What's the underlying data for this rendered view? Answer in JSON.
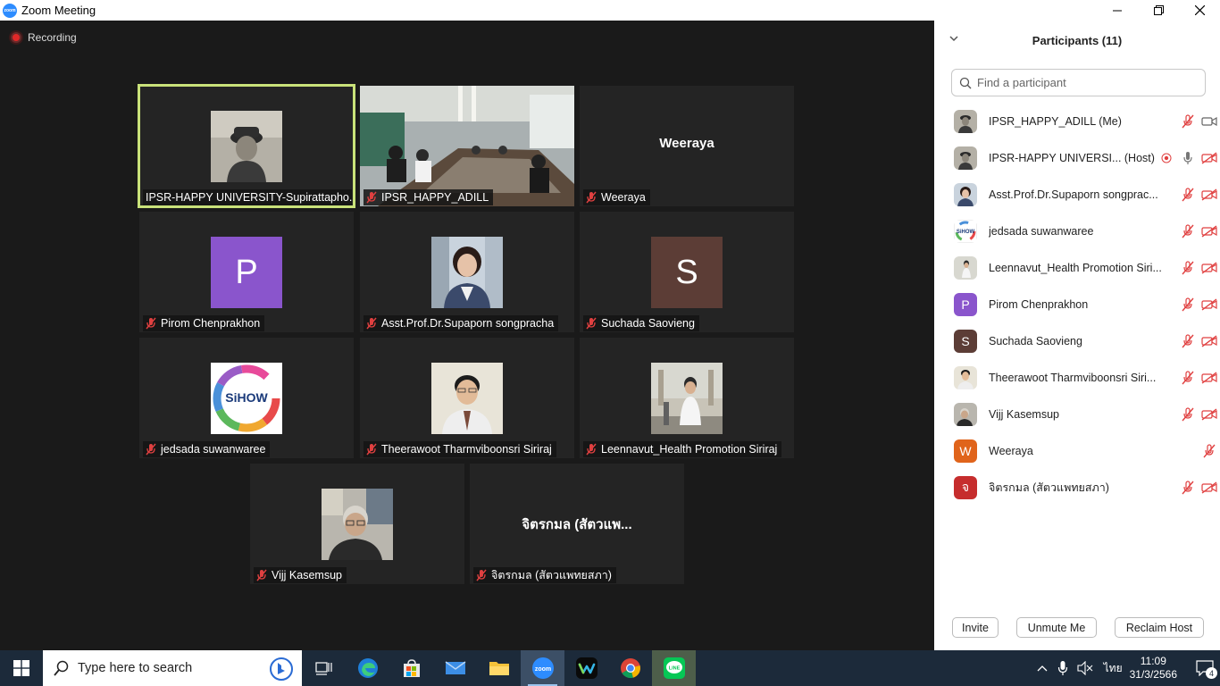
{
  "window": {
    "title": "Zoom Meeting",
    "minimize": "—",
    "restore": "❐",
    "close": "✕",
    "app_icon": "zoom"
  },
  "recording": {
    "label": "Recording"
  },
  "tiles": [
    {
      "name": "IPSR-HAPPY UNIVERSITY-Supirattapho...",
      "kind": "photo-bw",
      "muted": false
    },
    {
      "name": "IPSR_HAPPY_ADILL",
      "kind": "video-room",
      "muted": true
    },
    {
      "name": "Weeraya",
      "kind": "text",
      "center_text": "Weeraya",
      "muted": true
    },
    {
      "name": "Pirom Chenprakhon",
      "kind": "avatar",
      "initial": "P",
      "color": "#8a55cc",
      "muted": true
    },
    {
      "name": "Asst.Prof.Dr.Supaporn songpracha",
      "kind": "photo-woman",
      "muted": true
    },
    {
      "name": "Suchada Saovieng",
      "kind": "avatar",
      "initial": "S",
      "color": "#5c3d36",
      "muted": true
    },
    {
      "name": "jedsada suwanwaree",
      "kind": "logo-sihow",
      "logo_text": "SiHOW",
      "muted": true
    },
    {
      "name": "Theerawoot Tharmviboonsri Siriraj",
      "kind": "photo-man",
      "muted": true
    },
    {
      "name": "Leennavut_Health Promotion Siriraj",
      "kind": "photo-outdoor",
      "muted": true
    },
    {
      "name": "Vijj Kasemsup",
      "kind": "photo-elder",
      "muted": true
    },
    {
      "name": "จิตรกมล (สัตวแพทยสภา)",
      "kind": "text",
      "center_text": "จิตรกมล (สัตวแพ...",
      "muted": true
    }
  ],
  "panel": {
    "title": "Participants (11)",
    "search_placeholder": "Find a participant",
    "participants": [
      {
        "name": "IPSR_HAPPY_ADILL (Me)",
        "avatar": "photo-bw",
        "mic": "muted",
        "video": "on"
      },
      {
        "name": "IPSR-HAPPY UNIVERSI... (Host)",
        "avatar": "photo-bw",
        "mic": "active",
        "video": "off",
        "recording": true
      },
      {
        "name": "Asst.Prof.Dr.Supaporn songprac...",
        "avatar": "photo-woman",
        "mic": "muted",
        "video": "off"
      },
      {
        "name": "jedsada suwanwaree",
        "avatar": "logo-sihow",
        "mic": "muted",
        "video": "off"
      },
      {
        "name": "Leennavut_Health Promotion Siri...",
        "avatar": "photo-outdoor",
        "mic": "muted",
        "video": "off"
      },
      {
        "name": "Pirom Chenprakhon",
        "avatar": "initial",
        "initial": "P",
        "color": "#8a55cc",
        "mic": "muted",
        "video": "off"
      },
      {
        "name": "Suchada Saovieng",
        "avatar": "initial",
        "initial": "S",
        "color": "#5c3d36",
        "mic": "muted",
        "video": "off"
      },
      {
        "name": "Theerawoot Tharmviboonsri Siri...",
        "avatar": "photo-man",
        "mic": "muted",
        "video": "off"
      },
      {
        "name": "Vijj Kasemsup",
        "avatar": "photo-elder",
        "mic": "muted",
        "video": "off"
      },
      {
        "name": "Weeraya",
        "avatar": "initial",
        "initial": "W",
        "color": "#e0641b",
        "mic": "muted",
        "video": "none"
      },
      {
        "name": "จิตรกมล (สัตวแพทยสภา)",
        "avatar": "initial",
        "initial": "จ",
        "color": "#c62d2d",
        "mic": "muted",
        "video": "off"
      }
    ],
    "buttons": {
      "invite": "Invite",
      "unmute": "Unmute Me",
      "reclaim": "Reclaim Host"
    }
  },
  "taskbar": {
    "search_placeholder": "Type here to search",
    "apps": [
      "task-view",
      "edge",
      "store",
      "mail",
      "file-explorer",
      "zoom",
      "webex",
      "chrome",
      "line"
    ],
    "active_app": "zoom",
    "language": "ไทย",
    "time": "11:09",
    "date": "31/3/2566",
    "notification_count": "4"
  }
}
